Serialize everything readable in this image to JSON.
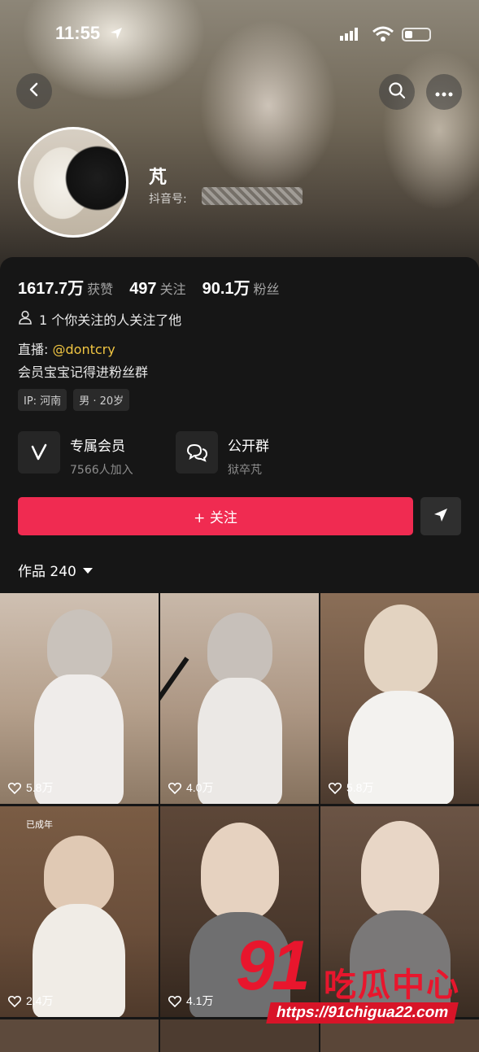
{
  "status_bar": {
    "time": "11:55"
  },
  "profile": {
    "name": "芃",
    "douyin_id_label": "抖音号:",
    "stats": [
      {
        "value": "1617.7万",
        "label": "获赞"
      },
      {
        "value": "497",
        "label": "关注"
      },
      {
        "value": "90.1万",
        "label": "粉丝"
      }
    ],
    "mutual": "1 个你关注的人关注了他",
    "live_prefix": "直播:",
    "live_handle": "@dontcry",
    "bio": "会员宝宝记得进粉丝群",
    "tags": [
      "IP: 河南",
      "男 · 20岁"
    ]
  },
  "features": [
    {
      "title": "专属会员",
      "subtitle": "7566人加入"
    },
    {
      "title": "公开群",
      "subtitle": "狱卒芃"
    }
  ],
  "follow_button": {
    "label": "+ 关注"
  },
  "works": {
    "label": "作品 240"
  },
  "videos": [
    {
      "likes": "5.8万"
    },
    {
      "likes": "4.0万"
    },
    {
      "likes": "5.8万"
    },
    {
      "likes": "2.4万",
      "note": "已成年"
    },
    {
      "likes": "4.1万"
    },
    {
      "likes": ""
    }
  ],
  "watermark": {
    "number": "91",
    "text": "吃瓜中心",
    "url": "https://91chigua22.com"
  },
  "colors": {
    "accent": "#f02b51",
    "live_handle": "#f0c542",
    "background": "#161616"
  }
}
